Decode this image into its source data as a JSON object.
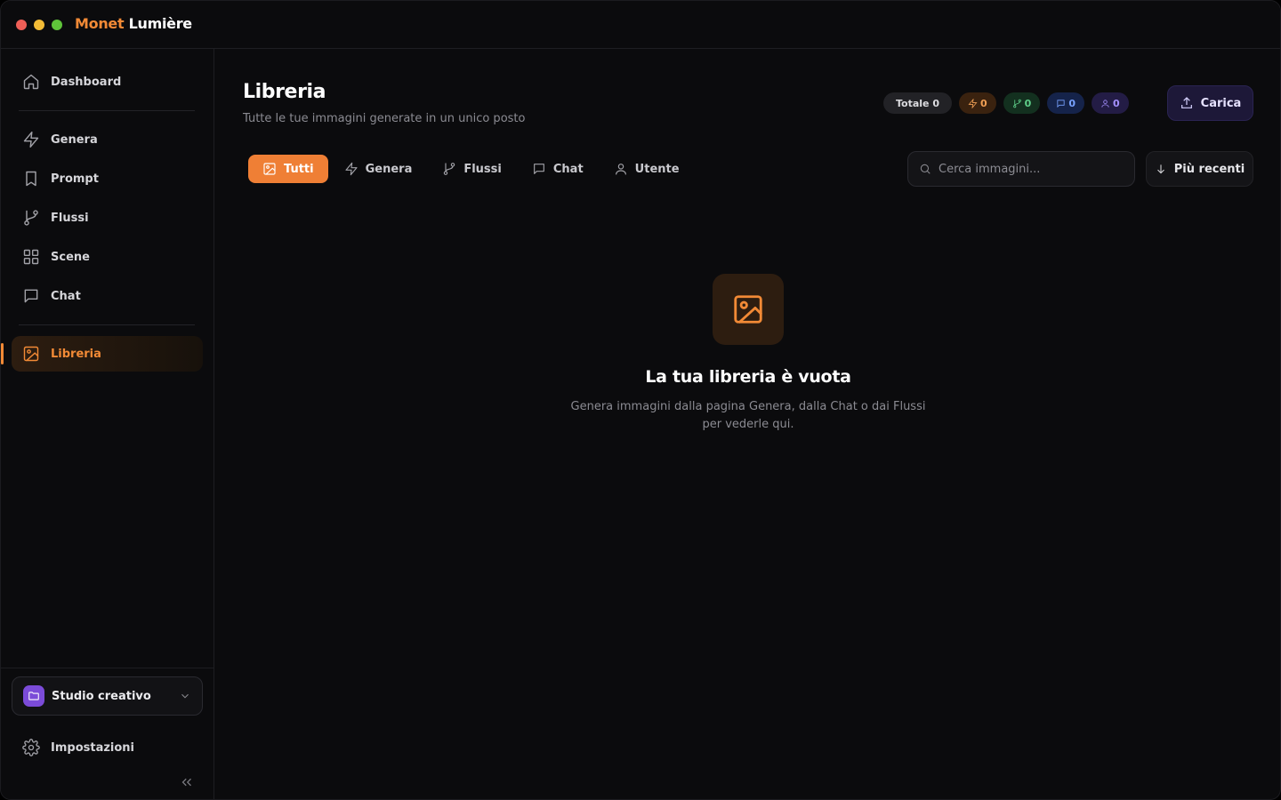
{
  "app": {
    "brand_part1": "Monet",
    "brand_part2": "Lumière"
  },
  "sidebar": {
    "items": [
      {
        "label": "Dashboard",
        "icon": "home-icon"
      },
      {
        "label": "Genera",
        "icon": "zap-icon"
      },
      {
        "label": "Prompt",
        "icon": "bookmark-icon"
      },
      {
        "label": "Flussi",
        "icon": "git-branch-icon"
      },
      {
        "label": "Scene",
        "icon": "grid-icon"
      },
      {
        "label": "Chat",
        "icon": "message-icon"
      },
      {
        "label": "Libreria",
        "icon": "image-icon",
        "active": true
      }
    ],
    "workspace": "Studio creativo",
    "settings": "Impostazioni"
  },
  "header": {
    "title": "Libreria",
    "subtitle": "Tutte le tue immagini generate in un unico posto",
    "stats": {
      "total_label": "Totale 0",
      "genera": "0",
      "flussi": "0",
      "chat": "0",
      "utente": "0"
    },
    "upload_label": "Carica"
  },
  "tabs": [
    {
      "label": "Tutti",
      "active": true
    },
    {
      "label": "Genera"
    },
    {
      "label": "Flussi"
    },
    {
      "label": "Chat"
    },
    {
      "label": "Utente"
    }
  ],
  "search": {
    "placeholder": "Cerca immagini...",
    "value": ""
  },
  "sort": {
    "label": "Più recenti"
  },
  "empty": {
    "title": "La tua libreria è vuota",
    "description": "Genera immagini dalla pagina Genera, dalla Chat o dai Flussi per vederle qui."
  },
  "colors": {
    "accent": "#ef7f35",
    "background": "#0b0b0d",
    "workspace": "#7b4bd8"
  }
}
